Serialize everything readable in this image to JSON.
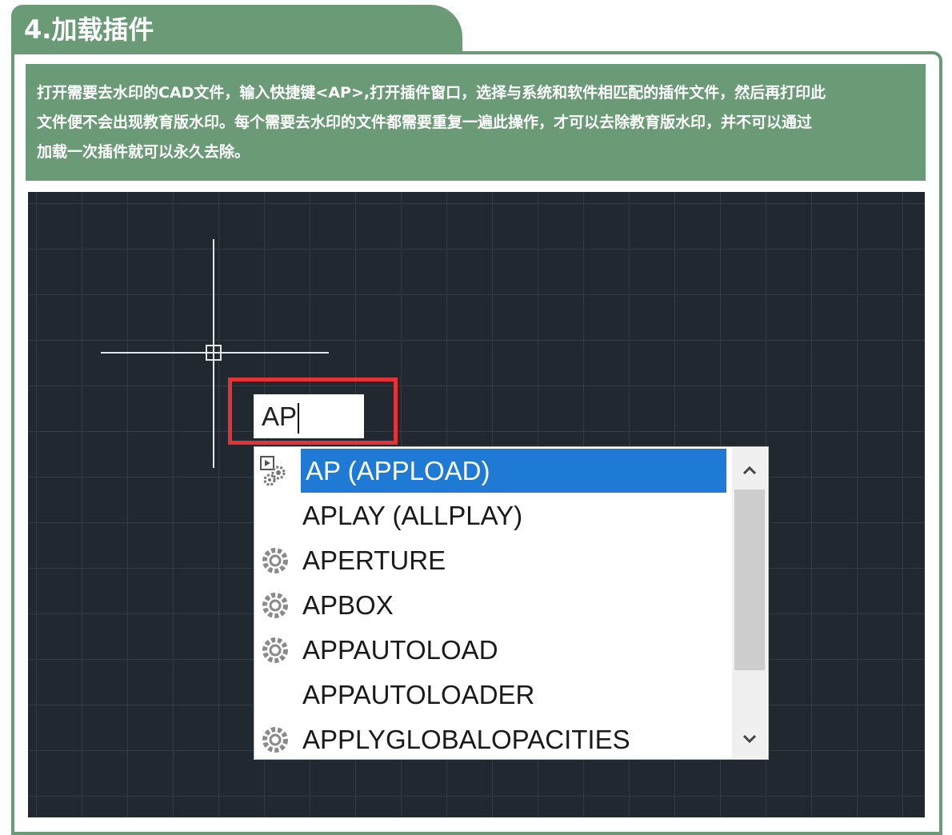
{
  "section": {
    "title": "4.加载插件",
    "description_lines": [
      "打开需要去水印的CAD文件，输入快捷键<AP>,打开插件窗口，选择与系统和软件相匹配的插件文件，然后再打印此",
      "文件便不会出现教育版水印。每个需要去水印的文件都需要重复一遍此操作，才可以去除教育版水印，并不可以通过",
      "加载一次插件就可以永久去除。"
    ]
  },
  "cad": {
    "command_input": "AP",
    "autocomplete": [
      {
        "label": "AP (APPLOAD)",
        "icon": "play-gear-icon",
        "selected": true
      },
      {
        "label": "APLAY (ALLPLAY)",
        "icon": "",
        "selected": false
      },
      {
        "label": "APERTURE",
        "icon": "gear-icon",
        "selected": false
      },
      {
        "label": "APBOX",
        "icon": "gear-icon",
        "selected": false
      },
      {
        "label": "APPAUTOLOAD",
        "icon": "gear-icon",
        "selected": false
      },
      {
        "label": "APPAUTOLOADER",
        "icon": "",
        "selected": false
      },
      {
        "label": "APPLYGLOBALOPACITIES",
        "icon": "gear-icon",
        "selected": false
      }
    ],
    "scroll_up_icon": "chevron-up-icon",
    "scroll_down_icon": "chevron-down-icon"
  },
  "colors": {
    "accent_green": "#6b9a77",
    "canvas_bg": "#212830",
    "selection_blue": "#1f7ad6",
    "highlight_red": "#e53236"
  }
}
